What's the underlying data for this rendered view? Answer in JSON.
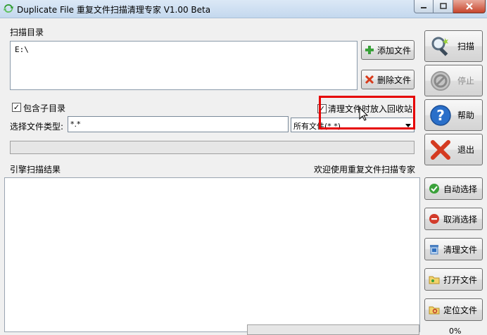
{
  "window": {
    "title": "Duplicate File 重复文件扫描清理专家 V1.00 Beta"
  },
  "scan_dir": {
    "label": "扫描目录",
    "paths": [
      "E:\\"
    ],
    "add_button": "添加文件",
    "delete_button": "删除文件"
  },
  "options": {
    "include_subdirs": "包含子目录",
    "include_subdirs_checked": true,
    "recycle_on_clean": "清理文件时放入回收站",
    "recycle_on_clean_checked": true,
    "file_type_label": "选择文件类型:",
    "file_type_value": "*.*",
    "file_type_select": "所有文件(*.*)"
  },
  "results": {
    "label": "引擎扫描结果",
    "welcome": "欢迎使用重复文件扫描专家",
    "progress_text": "0%",
    "progress": 0
  },
  "sidebar": {
    "scan": "扫描",
    "stop": "停止",
    "help": "帮助",
    "exit": "退出",
    "auto_select": "自动选择",
    "cancel_select": "取消选择",
    "clean_files": "清理文件",
    "open_file": "打开文件",
    "locate_file": "定位文件"
  },
  "colors": {
    "highlight": "#e60000",
    "titlebar": "#c4d8ee"
  }
}
